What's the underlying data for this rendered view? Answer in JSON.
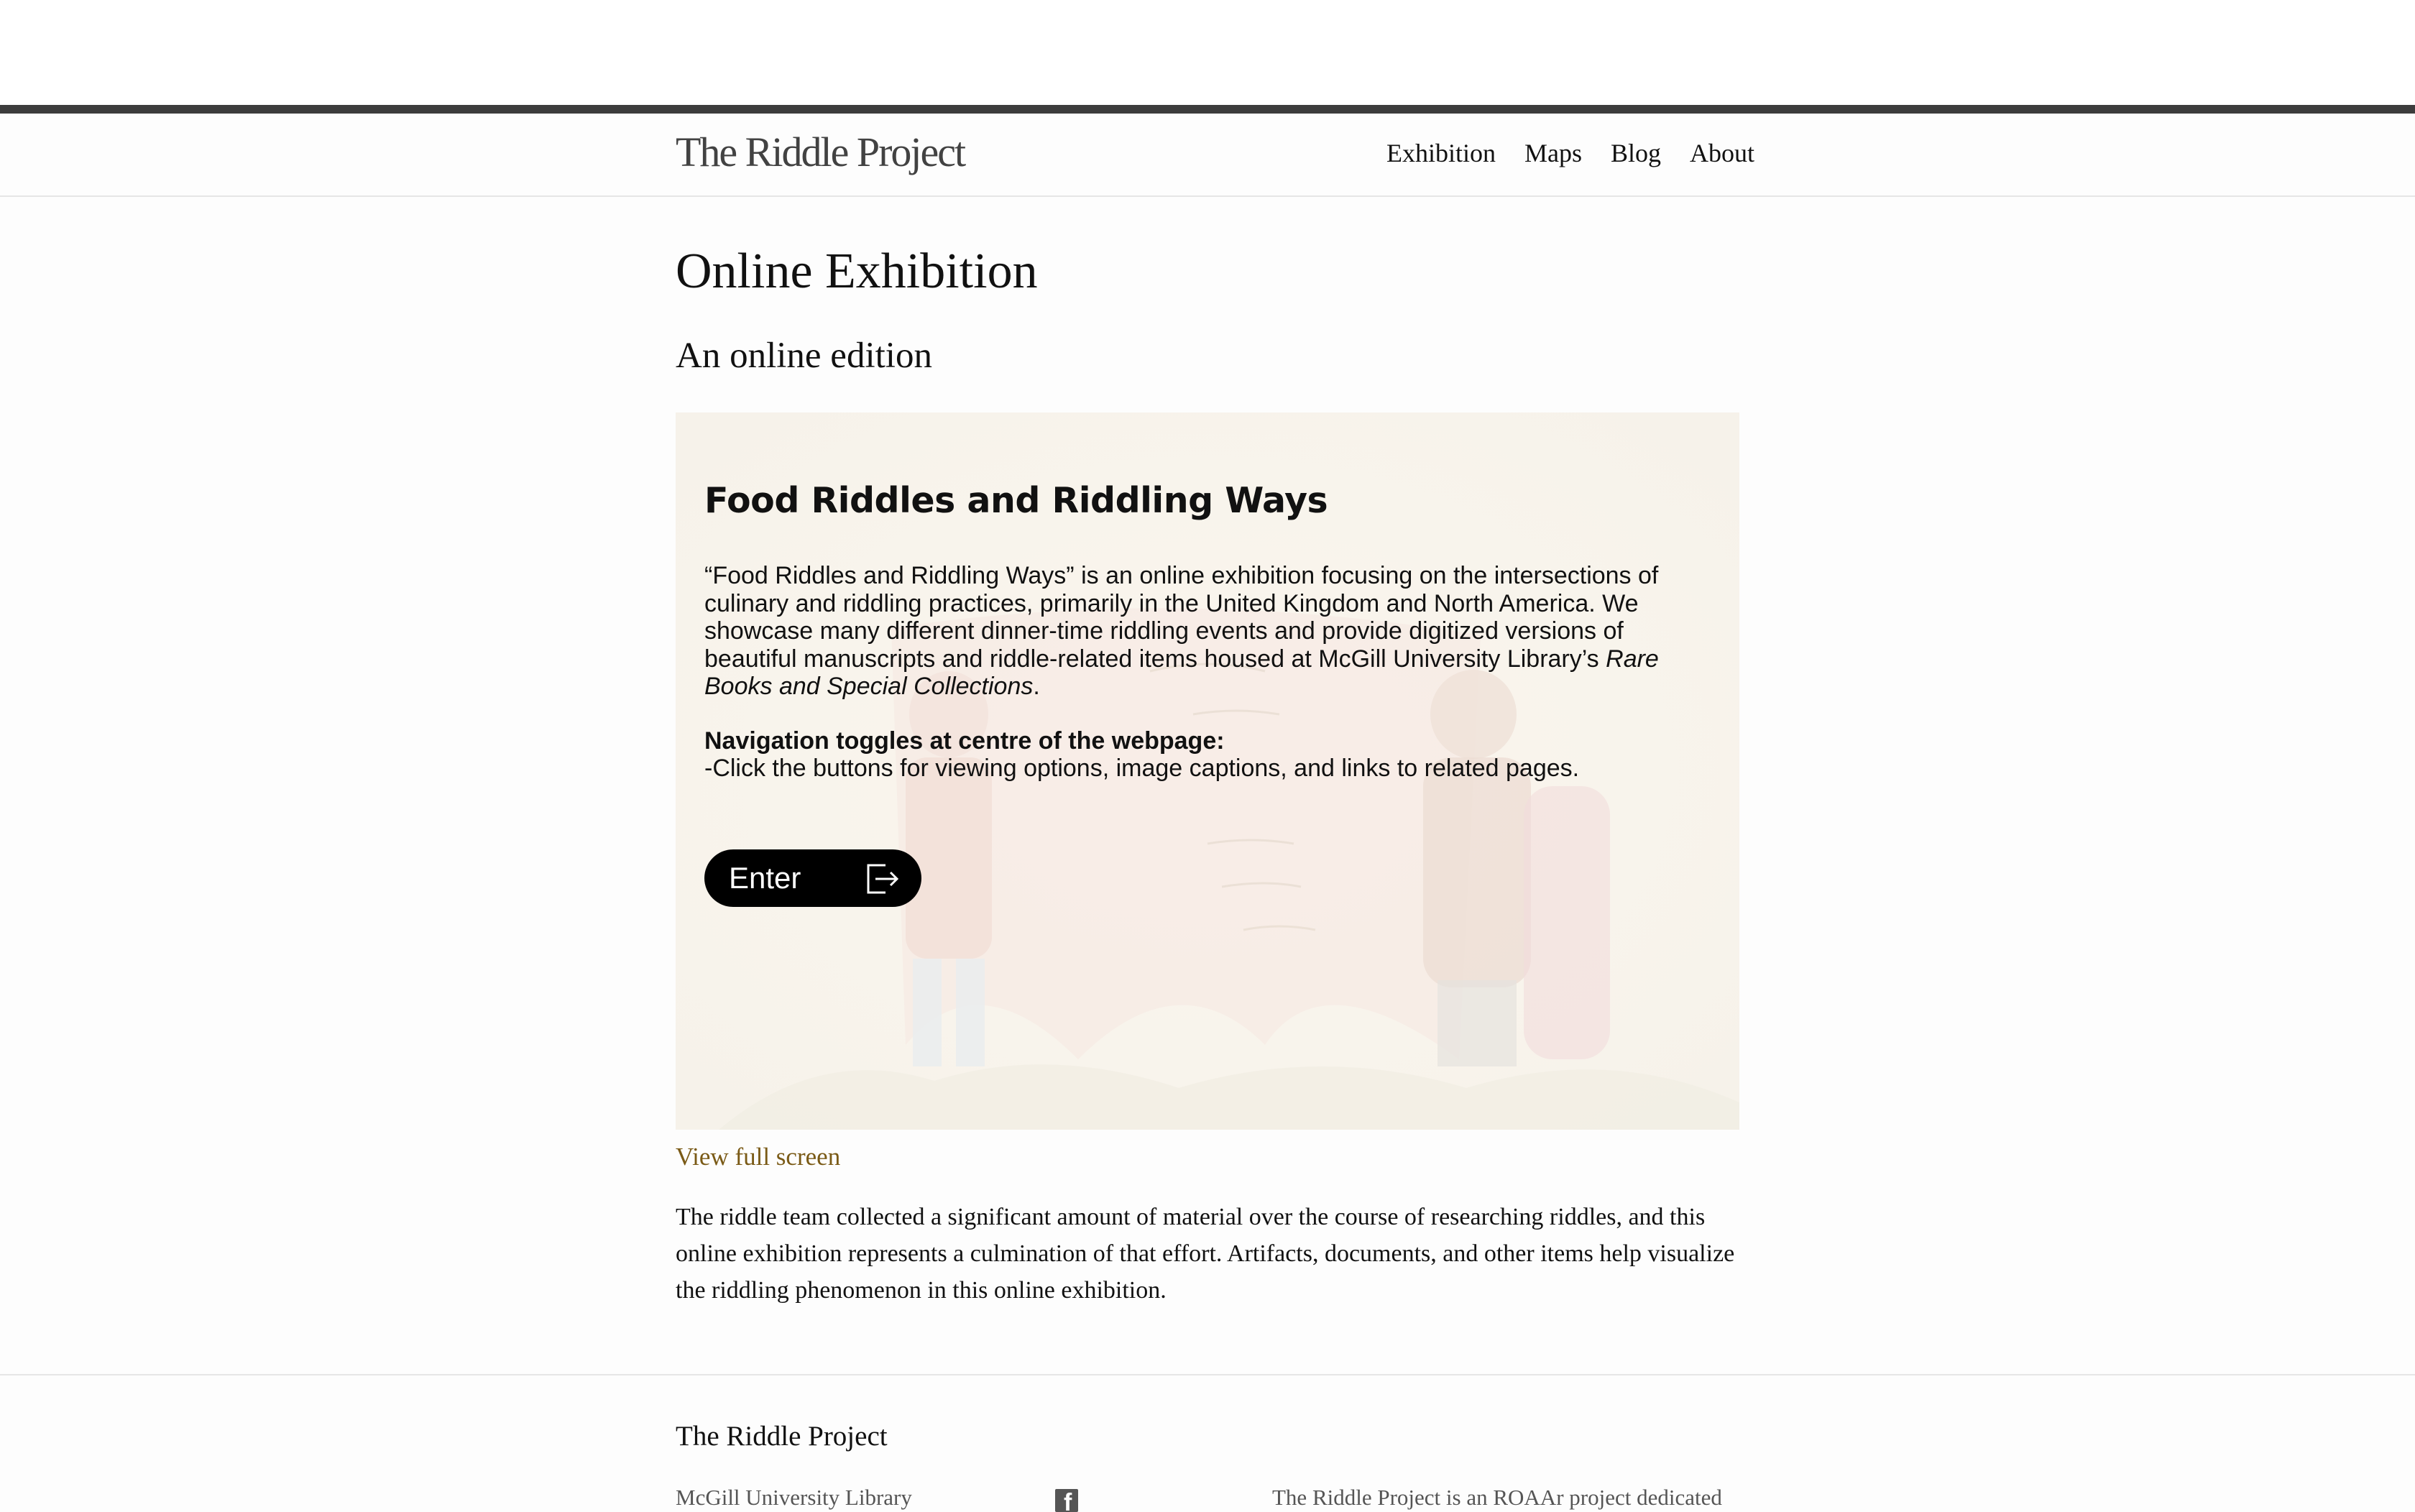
{
  "header": {
    "brand": "The Riddle Project",
    "nav": [
      {
        "label": "Exhibition"
      },
      {
        "label": "Maps"
      },
      {
        "label": "Blog"
      },
      {
        "label": "About"
      }
    ]
  },
  "main": {
    "title": "Online Exhibition",
    "subtitle": "An online edition",
    "exhibit": {
      "title": "Food Riddles and Riddling Ways",
      "desc_before": "“Food Riddles and Riddling Ways” is an online exhibition focusing on the intersections of culinary and riddling practices, primarily in the United Kingdom and North America. We showcase many different dinner-time riddling events and provide digitized versions of beautiful manuscripts and riddle-related items housed at McGill University Library’s ",
      "desc_italic": "Rare Books and Special Collections",
      "desc_after": ".",
      "nav_heading": "Navigation toggles at centre of the webpage:",
      "nav_text": "-Click the buttons for viewing options, image captions, and links to related pages.",
      "enter_label": "Enter"
    },
    "fullscreen_label": "View full screen",
    "body": "The riddle team collected a significant amount of material over the course of researching riddles, and this online exhibition represents a culmination of that effort. Artifacts, documents, and other items help visualize the riddling phenomenon in this online exhibition."
  },
  "footer": {
    "title": "The Riddle Project",
    "library": "McGill University Library",
    "blurb": "The Riddle Project is an ROAAr project dedicated"
  }
}
